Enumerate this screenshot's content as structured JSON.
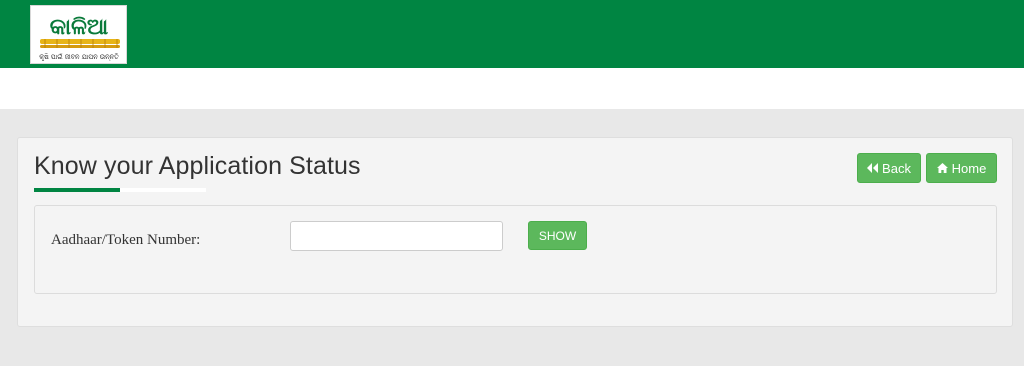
{
  "header": {
    "logo": {
      "title_text": "କାଳିଆ",
      "tagline_text": "କୃଷି ପାଇଁ ଜୀବନ ଯାପନ ଉନ୍ନତି",
      "brand_color": "#008542"
    },
    "bar_color": "#008542"
  },
  "panel": {
    "title": "Know your Application Status",
    "back_label": "Back",
    "home_label": "Home",
    "back_icon": "backward-icon",
    "home_icon": "home-icon",
    "button_color": "#5cb85c"
  },
  "form": {
    "field_label": "Aadhaar/Token Number:",
    "input_value": "",
    "input_placeholder": "",
    "show_label": "SHOW"
  }
}
